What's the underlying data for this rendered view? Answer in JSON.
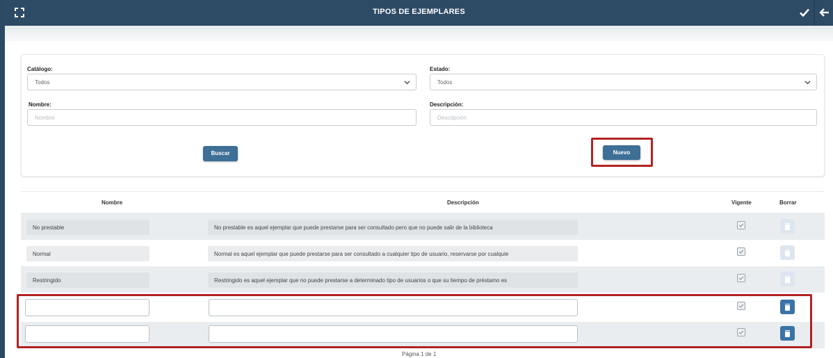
{
  "header": {
    "title": "TIPOS DE EJEMPLARES",
    "icons": [
      "expand-icon",
      "check-icon",
      "back-arrow-icon"
    ]
  },
  "filters": {
    "catalogo_label": "Catálogo:",
    "catalogo_value": "Todos",
    "estado_label": "Estado:",
    "estado_value": "Todos",
    "nombre_label": "Nombre:",
    "nombre_placeholder": "Nombre",
    "descripcion_label": "Descripción:",
    "descripcion_placeholder": "Descripción",
    "buscar_label": "Buscar",
    "nuevo_label": "Nuevo"
  },
  "table": {
    "columns": {
      "nombre": "Nombre",
      "descripcion": "Descripción",
      "vigente": "Vigente",
      "borrar": "Borrar"
    },
    "rows": [
      {
        "nombre": "No prestable",
        "descripcion": "No prestable es aquel ejemplar que puede prestarse para ser consultado pero que no puede salir de la biblioteca",
        "vigente": true
      },
      {
        "nombre": "Normal",
        "descripcion": "Normal es aquel ejemplar que puede prestarse para ser consultado a cualquier tipo de usuario, reservarse por cualquie",
        "vigente": true
      },
      {
        "nombre": "Restringido",
        "descripcion": "Restringido es aquel ejemplar que no puede prestarse a determinado tipo de usuarios o que su tiempo de préstamo es",
        "vigente": true
      },
      {
        "nombre": "",
        "descripcion": "",
        "vigente": true,
        "new": true
      },
      {
        "nombre": "",
        "descripcion": "",
        "vigente": true,
        "new": true
      }
    ]
  },
  "pager": {
    "text": "Página 1 de 1"
  },
  "colors": {
    "header_bg": "#2e4b66",
    "button_bg": "#3e6f96",
    "highlight": "#b22222",
    "trash_active": "#3a73a7"
  }
}
